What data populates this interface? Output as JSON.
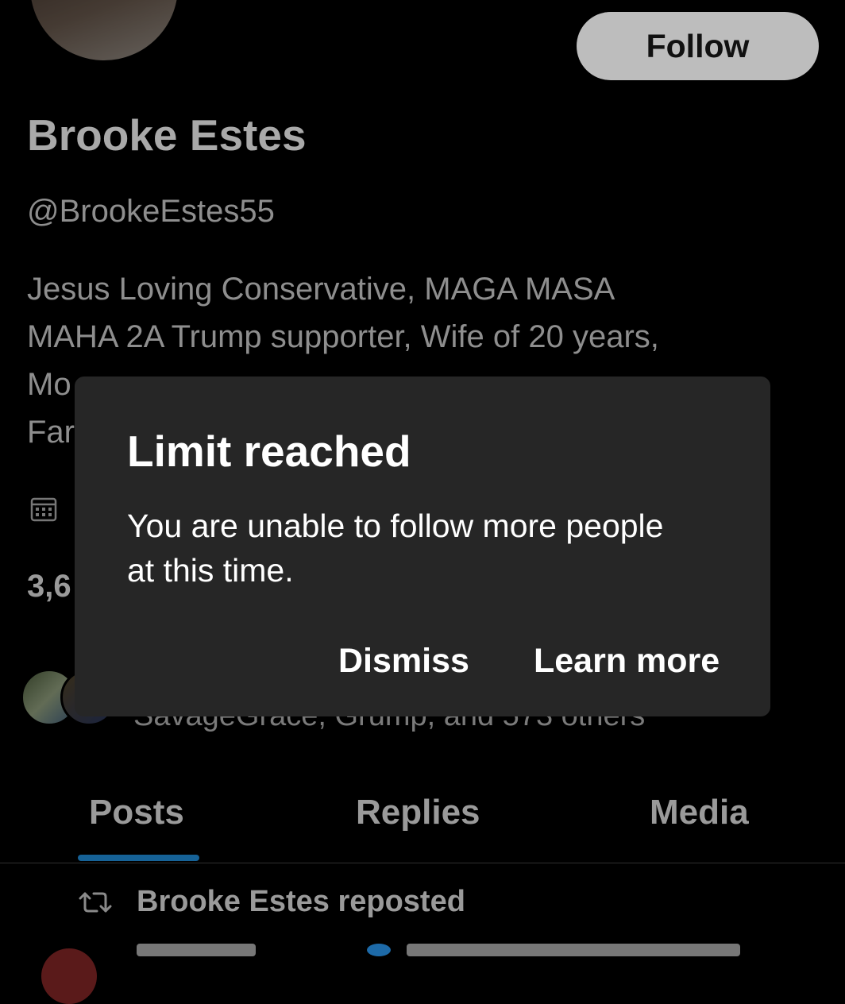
{
  "profile": {
    "follow_label": "Follow",
    "name": "Brooke Estes",
    "handle": "@BrookeEstes55",
    "bio_lines": [
      "Jesus Loving Conservative, MAGA MASA",
      "MAHA 2A Trump supporter, Wife of 20 years,",
      "Mo",
      "Far"
    ],
    "stat_fragment": "3,6",
    "followed_by_text": "SavageGrace, Grump, and 573 others"
  },
  "tabs": [
    {
      "label": "Posts"
    },
    {
      "label": "Replies"
    },
    {
      "label": "Media"
    }
  ],
  "feed": {
    "repost_text": "Brooke Estes reposted"
  },
  "modal": {
    "title": "Limit reached",
    "body": "You are unable to follow more people at this time.",
    "dismiss_label": "Dismiss",
    "learn_more_label": "Learn more"
  },
  "colors": {
    "accent": "#1d9bf0",
    "modal_bg": "#262626"
  }
}
